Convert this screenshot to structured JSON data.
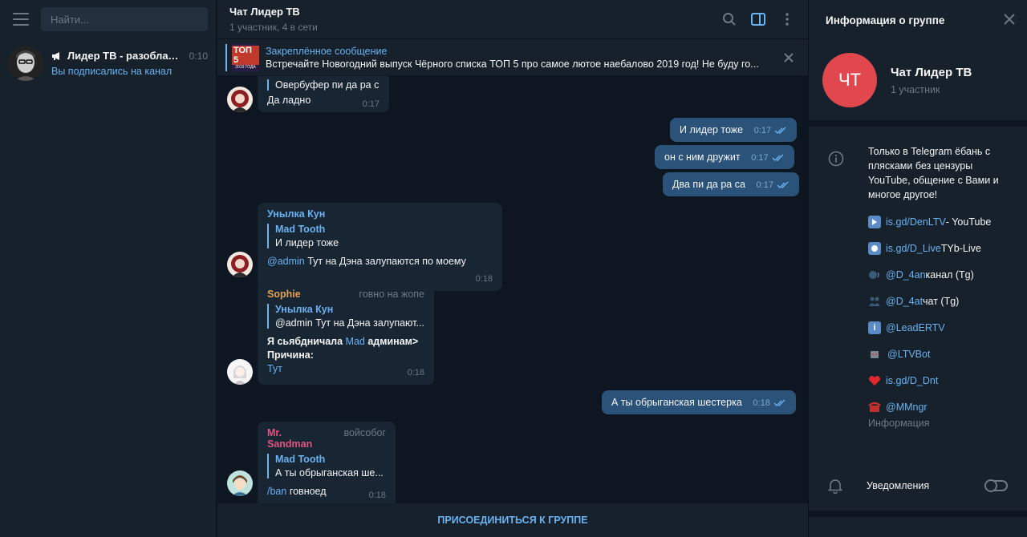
{
  "sidebar": {
    "search_placeholder": "Найти...",
    "dialogs": [
      {
        "name": "Лидер ТВ - разоблаче...",
        "time": "0:10",
        "subtitle": "Вы подписались на канал"
      }
    ]
  },
  "chat": {
    "title": "Чат Лидер ТВ",
    "subtitle": "1 участник, 4 в сети",
    "pinned": {
      "title": "Закреплённое сообщение",
      "text": "Встречайте Новогодний выпуск Чёрного списка ТОП 5 про самое лютое наебалово 2019 год! Не буду го...",
      "thumb_top": "ТОП 5",
      "thumb_bottom": "2019 ГОДА"
    },
    "messages": {
      "m1_reply": "Овербуфер пи да ра с",
      "m1_text": "Да ладно",
      "m1_time": "0:17",
      "o1_text": "И лидер тоже",
      "o1_time": "0:17",
      "o2_text": "он с ним дружит",
      "o2_time": "0:17",
      "o3_text": "Два пи да ра са",
      "o3_time": "0:17",
      "m2_sender": "Унылка Кун",
      "m2_reply_name": "Mad Tooth",
      "m2_reply_text": "И лидер тоже",
      "m2_mention": "@admin",
      "m2_text": " Тут на Дэна залупаются по моему",
      "m2_time": "0:18",
      "m3_sender": "Sophie",
      "m3_role": "говно на жопе",
      "m3_reply_name": "Унылка Кун",
      "m3_reply_text": "@admin Тут на Дэна залупают...",
      "m3_text_a": "Я сьябдничала ",
      "m3_text_link": "Mad",
      "m3_text_b": " админам>",
      "m3_text_c": "Причина:",
      "m3_text_d": "Тут",
      "m3_time": "0:18",
      "o4_text": "А ты обрыганская шестерка",
      "o4_time": "0:18",
      "m4_sender": "Mr. Sandman",
      "m4_role": "войсобог",
      "m4_reply_name": "Mad Tooth",
      "m4_reply_text": "А ты обрыганская ше...",
      "m4_cmd": "/ban",
      "m4_text": " говноед",
      "m4_time": "0:18"
    },
    "join_label": "ПРИСОЕДИНИТЬСЯ К ГРУППЕ"
  },
  "info_panel": {
    "title": "Информация о группе",
    "group_initials": "ЧТ",
    "group_name": "Чат Лидер ТВ",
    "group_members": "1 участник",
    "description": "Только в Telegram ёбань с плясками без цензуры YouTube, общение с Вами и многое другое!",
    "links": [
      {
        "link": "is.gd/DenLTV",
        "suffix": " - YouTube",
        "icon": "play-icon"
      },
      {
        "link": "is.gd/D_Live",
        "suffix": " TYb-Live",
        "icon": "record-icon"
      },
      {
        "link": "@D_4an",
        "suffix": " канал (Tg)",
        "icon": "speaking-head-icon"
      },
      {
        "link": "@D_4at",
        "suffix": " чат (Tg)",
        "icon": "people-icon"
      },
      {
        "link": "@LeadERTV",
        "suffix": "",
        "icon": "info-square-icon"
      },
      {
        "link": "@LTVBot",
        "suffix": "",
        "icon": "robot-icon"
      },
      {
        "link": "is.gd/D_Dnt",
        "suffix": "",
        "icon": "heart-icon"
      },
      {
        "link": "@MMngr",
        "suffix": "",
        "icon": "telephone-icon"
      }
    ],
    "info_label": "Информация",
    "notifications_label": "Уведомления",
    "notifications_enabled": false
  },
  "colors": {
    "accent": "#6ab2f2",
    "outgoing_bubble": "#2b5278",
    "incoming_bubble": "#182533",
    "group_avatar": "#e0484e",
    "sender_sophie": "#e5a050",
    "sender_unylka": "#6ab2f2",
    "sender_sandman": "#e0557f"
  }
}
